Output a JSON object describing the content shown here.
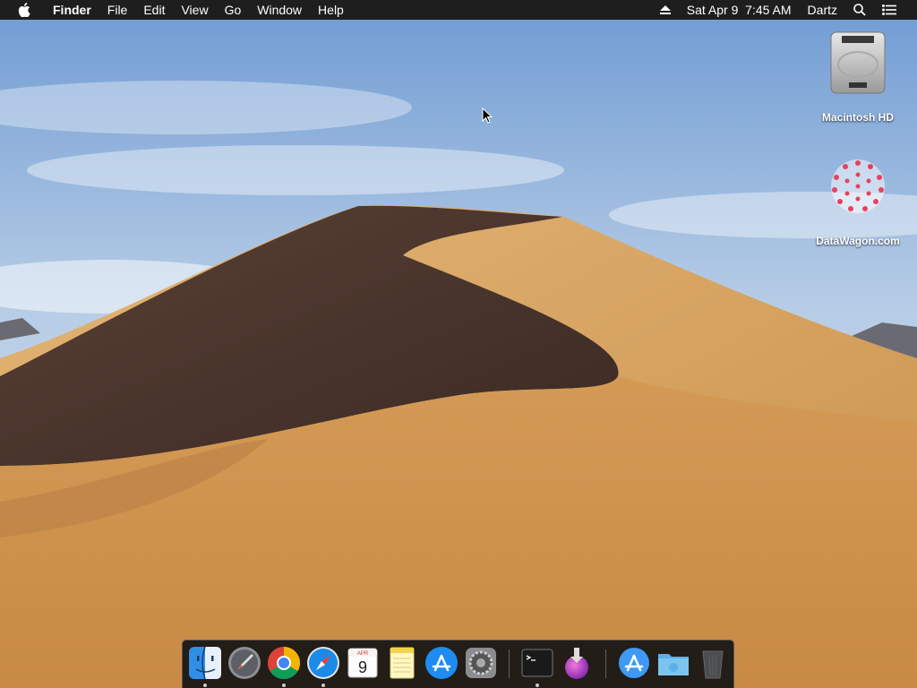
{
  "menubar": {
    "app_name": "Finder",
    "items": [
      "File",
      "Edit",
      "View",
      "Go",
      "Window",
      "Help"
    ],
    "datetime": "Sat Apr 9  7:45 AM",
    "user": "Dartz"
  },
  "desktop": {
    "icons": [
      {
        "label": "Macintosh HD",
        "icon": "hard-drive-icon"
      },
      {
        "label": "DataWagon.com",
        "icon": "datawagon-icon"
      }
    ]
  },
  "dock": {
    "items": [
      {
        "name": "Finder",
        "icon": "finder-icon",
        "running": true
      },
      {
        "name": "Launchpad",
        "icon": "launchpad-icon",
        "running": false
      },
      {
        "name": "Google Chrome",
        "icon": "chrome-icon",
        "running": true
      },
      {
        "name": "Safari",
        "icon": "safari-icon",
        "running": true
      },
      {
        "name": "Calendar",
        "icon": "calendar-icon",
        "running": false,
        "month": "APR",
        "day": "9"
      },
      {
        "name": "Notes",
        "icon": "notes-icon",
        "running": false
      },
      {
        "name": "App Store",
        "icon": "app-store-icon",
        "running": false
      },
      {
        "name": "System Preferences",
        "icon": "system-preferences-icon",
        "running": false
      },
      {
        "name": "Terminal",
        "icon": "terminal-icon",
        "running": true
      },
      {
        "name": "Installer",
        "icon": "installer-icon",
        "running": false
      },
      {
        "name": "Applications",
        "icon": "applications-folder-icon",
        "running": false
      },
      {
        "name": "Downloads",
        "icon": "downloads-folder-icon",
        "running": false
      },
      {
        "name": "Trash",
        "icon": "trash-icon",
        "running": false
      }
    ]
  },
  "colors": {
    "menubar_bg": "#1e1e1e",
    "sky_top": "#6f9bd3",
    "sand": "#d9a464"
  }
}
